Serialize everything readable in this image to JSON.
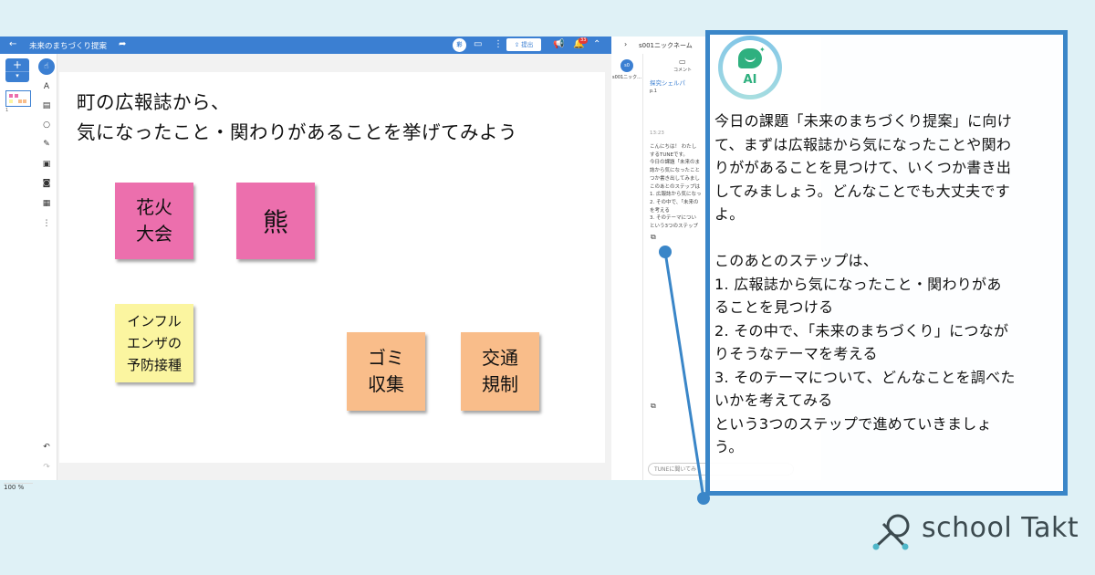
{
  "app": {
    "title": "未来のまちづくり提案",
    "submit_label": "提出",
    "notification_count": "33",
    "avatar_initials": "彩",
    "zoom_value": "100",
    "zoom_unit": "%",
    "thumbnail_number": "1"
  },
  "canvas": {
    "title_line1": "町の広報誌から、",
    "title_line2": "気になったこと・関わりがあることを挙げてみよう",
    "notes": [
      {
        "text": "花火\n大会",
        "color": "#ec6fad"
      },
      {
        "text": "熊",
        "color": "#ec6fad"
      },
      {
        "text": "インフル\nエンザの\n予防接種",
        "color": "#fbf5a0"
      },
      {
        "text": "ゴミ\n収集",
        "color": "#f9bd8a"
      },
      {
        "text": "交通\n規制",
        "color": "#f9bd8a"
      }
    ]
  },
  "side_panel": {
    "user_name": "s001ニックネーム",
    "nav_label": "s001ニック...",
    "nav_avatar": "s0",
    "tab_label": "コメント",
    "section_title": "探究シェルパ",
    "section_sub": "p.1",
    "time": "13:23",
    "preview_lines": [
      "こんにちは！ わたし",
      "するTUNEです。",
      "今日の課題「未来のま",
      "誌から気になったこと",
      "つか書き出してみまし",
      "このあとのステップは",
      "1. 広報誌から気になっ",
      "2. その中で、「未来の",
      "を考える",
      "3. そのテーマについ",
      "という3つのステップ"
    ],
    "input_placeholder": "TUNEに聞いてみ"
  },
  "callout": {
    "ai_label": "AI",
    "message": "今日の課題「未来のまちづくり提案」に向け\nて、まずは広報誌から気になったことや関わ\nりががあることを見つけて、いくつか書き出\nしてみましょう。どんなことでも大丈夫です\nよ。\n\nこのあとのステップは、\n1. 広報誌から気になったこと・関わりがあ\nることを見つける\n2. その中で、「未来のまちづくり」につなが\nりそうなテーマを考える\n3. そのテーマについて、どんなことを調べた\nいかを考えてみる\nという3つのステップで進めていきましょ\nう。"
  },
  "logo": {
    "text": "school Takt"
  },
  "colors": {
    "topbar": "#3b7fd2",
    "callout_border": "#3a86c8",
    "background": "#dff1f6",
    "ai_green": "#2fb07f"
  }
}
